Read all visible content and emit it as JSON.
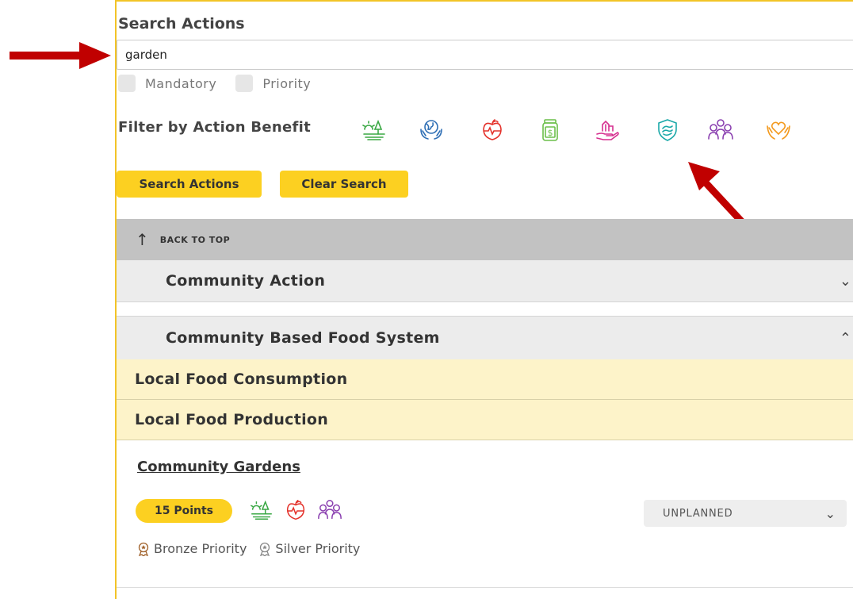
{
  "search": {
    "title": "Search Actions",
    "value": "garden",
    "checkboxes": [
      {
        "label": "Mandatory",
        "checked": false
      },
      {
        "label": "Priority",
        "checked": false
      }
    ]
  },
  "filter": {
    "label": "Filter by Action Benefit",
    "icons": [
      {
        "name": "environment-icon",
        "color": "#3aa844"
      },
      {
        "name": "globe-hands-icon",
        "color": "#2f6fb5"
      },
      {
        "name": "apple-health-icon",
        "color": "#e4322b"
      },
      {
        "name": "money-jar-icon",
        "color": "#6cbf4a"
      },
      {
        "name": "hand-building-icon",
        "color": "#d62f8f"
      },
      {
        "name": "shield-icon",
        "color": "#1aa8a8"
      },
      {
        "name": "community-icon",
        "color": "#8a3fb0"
      },
      {
        "name": "heart-hands-icon",
        "color": "#f39a1f"
      }
    ]
  },
  "buttons": {
    "search": "Search Actions",
    "clear": "Clear Search"
  },
  "back_to_top": "BACK TO TOP",
  "categories": [
    {
      "title": "Community Action",
      "expanded": false
    },
    {
      "title": "Community Based Food System",
      "expanded": true
    }
  ],
  "subcategories": [
    "Local Food Consumption",
    "Local Food Production"
  ],
  "action": {
    "title": "Community Gardens",
    "points": "15 Points",
    "status": "UNPLANNED",
    "badges": [
      "Bronze Priority",
      "Silver Priority"
    ]
  },
  "colors": {
    "accent": "#fcd021",
    "border": "#f2c428",
    "arrow": "#c00000"
  }
}
